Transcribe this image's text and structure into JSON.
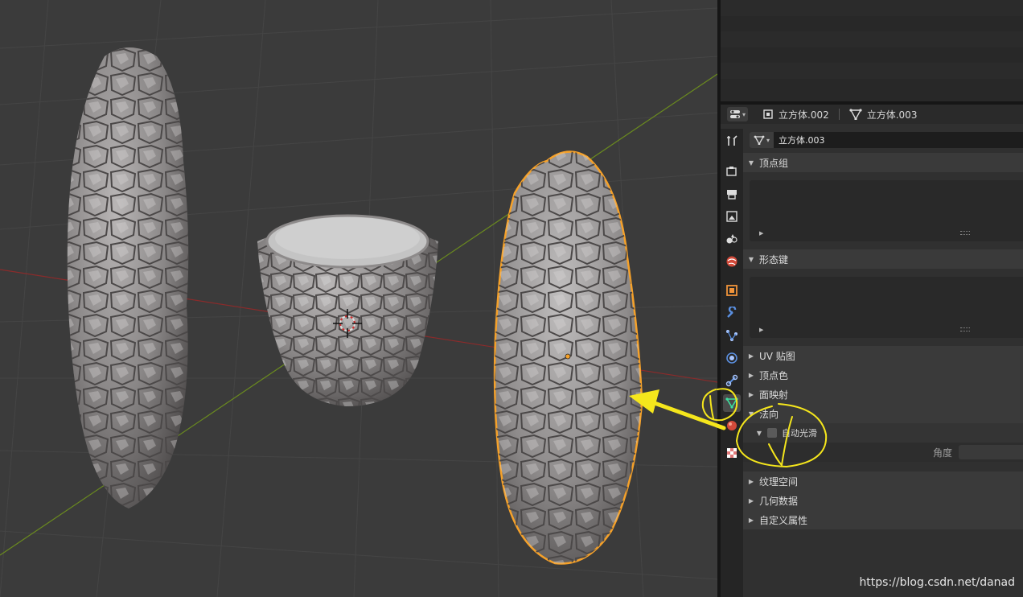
{
  "viewport": {
    "objects": [
      {
        "name": "rock-pillar-left"
      },
      {
        "name": "stone-cup-middle"
      },
      {
        "name": "rock-pillar-right-selected"
      }
    ]
  },
  "outliner": {
    "rows": 6
  },
  "props_header": {
    "object_name": "立方体.002",
    "mesh_name": "立方体.003"
  },
  "datablock": {
    "mesh_name": "立方体.003"
  },
  "sections": {
    "vertex_groups": "顶点组",
    "shape_keys": "形态键",
    "uv_maps": "UV 贴图",
    "vertex_colors": "顶点色",
    "face_maps": "面映射",
    "normals": "法向",
    "auto_smooth": "自动光滑",
    "angle": "角度",
    "texture_space": "纹理空间",
    "geometry_data": "几何数据",
    "custom_properties": "自定义属性"
  },
  "tabs": [
    "tool-icon",
    "render-icon",
    "output-icon",
    "view-layer-icon",
    "scene-icon",
    "world-icon",
    "object-icon",
    "modifier-icon",
    "particles-icon",
    "physics-icon",
    "constraints-icon",
    "mesh-data-icon",
    "material-icon",
    "texture-icon"
  ],
  "colors": {
    "selection_outline": "#f5a12a",
    "annotation": "#f5e61c",
    "x_axis": "#8a2b2b",
    "y_axis": "#6a8a1f",
    "mesh_data_icon": "#3ee0a0"
  },
  "watermark": "https://blog.csdn.net/danad"
}
